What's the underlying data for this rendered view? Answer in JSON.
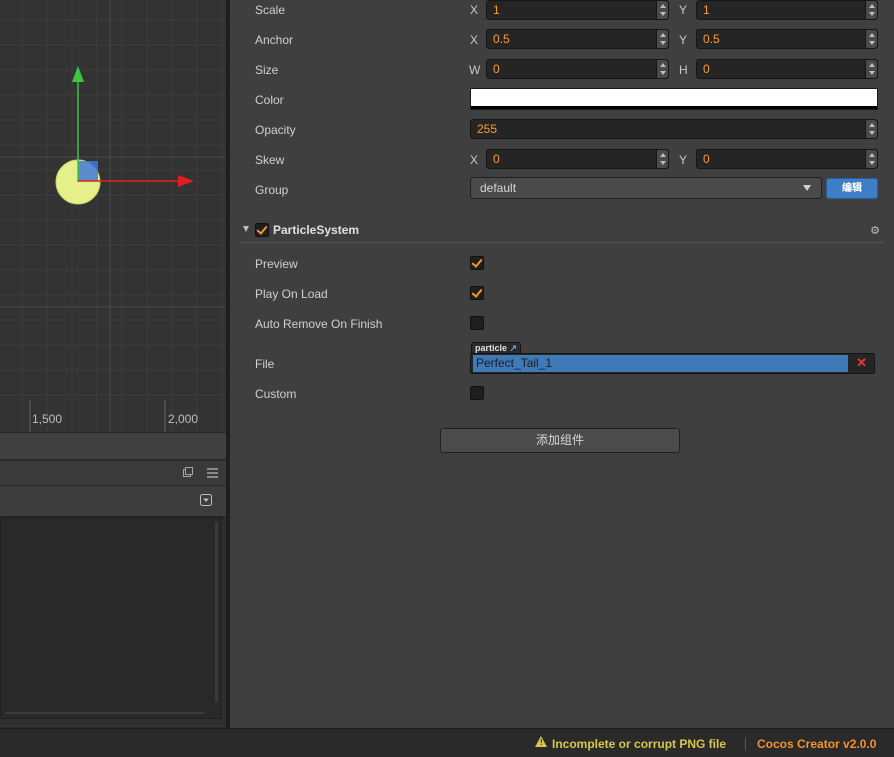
{
  "scene": {
    "ruler_labels": [
      "1,500",
      "2,000"
    ]
  },
  "assets_panel": {
    "header_icons": [
      "popout-icon",
      "menu-icon"
    ],
    "toolbar_icon": "dropdown-icon"
  },
  "inspector": {
    "properties": {
      "scale": {
        "label": "Scale",
        "x_label": "X",
        "x": "1",
        "y_label": "Y",
        "y": "1"
      },
      "anchor": {
        "label": "Anchor",
        "x_label": "X",
        "x": "0.5",
        "y_label": "Y",
        "y": "0.5"
      },
      "size": {
        "label": "Size",
        "w_label": "W",
        "w": "0",
        "h_label": "H",
        "h": "0"
      },
      "color": {
        "label": "Color",
        "value": "#ffffff"
      },
      "opacity": {
        "label": "Opacity",
        "value": "255"
      },
      "skew": {
        "label": "Skew",
        "x_label": "X",
        "x": "0",
        "y_label": "Y",
        "y": "0"
      },
      "group": {
        "label": "Group",
        "value": "default",
        "edit_label": "编辑"
      }
    },
    "particle_system": {
      "title": "ParticleSystem",
      "enabled": true,
      "preview": {
        "label": "Preview",
        "checked": true
      },
      "play_on_load": {
        "label": "Play On Load",
        "checked": true
      },
      "auto_remove": {
        "label": "Auto Remove On Finish",
        "checked": false
      },
      "file": {
        "label": "File",
        "tag": "particle",
        "value": "Perfect_Tail_1"
      },
      "custom": {
        "label": "Custom",
        "checked": false
      }
    },
    "add_component_label": "添加组件"
  },
  "status_bar": {
    "warning_text": "Incomplete or corrupt PNG file",
    "app_version": "Cocos Creator v2.0.0"
  },
  "colors": {
    "accent": "#fd9c2b",
    "button_blue": "#3d7ec6",
    "warning": "#d8c84a",
    "selection_blue": "#3f79b8"
  }
}
